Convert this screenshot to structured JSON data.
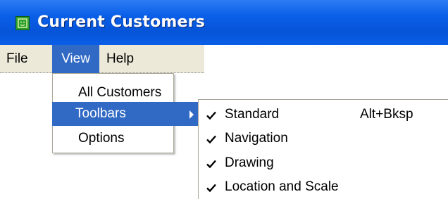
{
  "window": {
    "title": "Current Customers",
    "icon": "app-icon"
  },
  "menubar": {
    "items": [
      {
        "label": "File"
      },
      {
        "label": "View"
      },
      {
        "label": "Help"
      }
    ]
  },
  "view_menu": {
    "items": [
      {
        "label": "All Customers"
      },
      {
        "label": "Toolbars"
      },
      {
        "label": "Options"
      }
    ]
  },
  "toolbars_menu": {
    "items": [
      {
        "label": "Standard",
        "checked": true,
        "shortcut": "Alt+Bksp"
      },
      {
        "label": "Navigation",
        "checked": true,
        "shortcut": ""
      },
      {
        "label": "Drawing",
        "checked": true,
        "shortcut": ""
      },
      {
        "label": "Location and Scale",
        "checked": true,
        "shortcut": ""
      }
    ]
  },
  "colors": {
    "titlebar": "#0a5ee6",
    "highlight": "#316ac5",
    "menubar_bg": "#ece9d8"
  }
}
